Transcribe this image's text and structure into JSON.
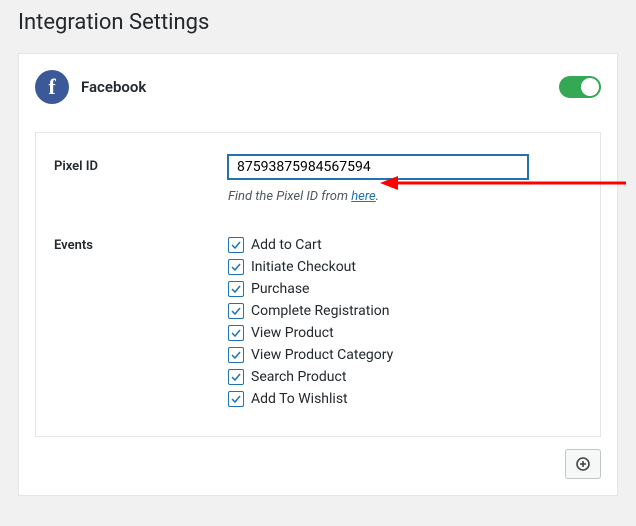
{
  "page": {
    "title": "Integration Settings"
  },
  "provider": {
    "name": "Facebook",
    "enabled": true
  },
  "fields": {
    "pixel_label": "Pixel ID",
    "pixel_value": "87593875984567594",
    "hint_prefix": "Find the Pixel ID from ",
    "hint_link": "here",
    "hint_suffix": ".",
    "events_label": "Events"
  },
  "events": [
    {
      "label": "Add to Cart",
      "checked": true
    },
    {
      "label": "Initiate Checkout",
      "checked": true
    },
    {
      "label": "Purchase",
      "checked": true
    },
    {
      "label": "Complete Registration",
      "checked": true
    },
    {
      "label": "View Product",
      "checked": true
    },
    {
      "label": "View Product Category",
      "checked": true
    },
    {
      "label": "Search Product",
      "checked": true
    },
    {
      "label": "Add To Wishlist",
      "checked": true
    }
  ],
  "annotation": {
    "arrow_color": "#ff0000"
  }
}
